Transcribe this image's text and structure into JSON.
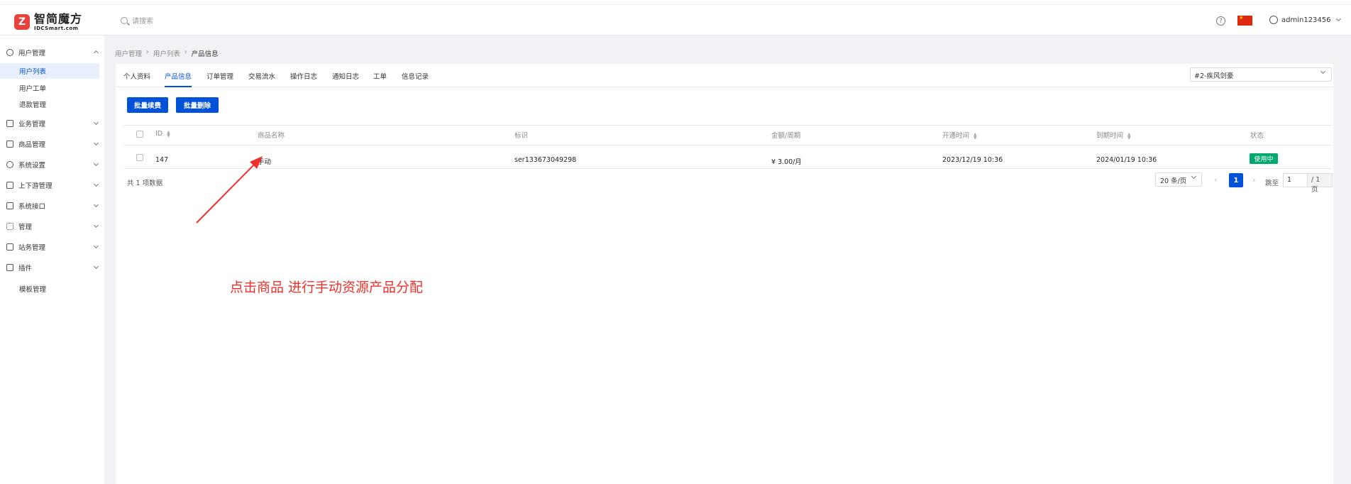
{
  "brand": {
    "name_cn": "智简魔方",
    "name_en": "IDCSmart.com",
    "mark": "Z",
    "color": "#e8403a"
  },
  "header": {
    "search_placeholder": "请搜索",
    "help": "?",
    "user": "admin123456",
    "flag": "cn"
  },
  "sidebar": {
    "items": [
      {
        "label": "用户管理",
        "icon": "user-icon",
        "expanded": true
      },
      {
        "label": "业务管理",
        "icon": "list-icon"
      },
      {
        "label": "商品管理",
        "icon": "cart-icon"
      },
      {
        "label": "系统设置",
        "icon": "gear-icon"
      },
      {
        "label": "上下游管理",
        "icon": "filter-icon"
      },
      {
        "label": "系统接口",
        "icon": "folder-icon"
      },
      {
        "label": "管理",
        "icon": "sun-icon"
      },
      {
        "label": "站务管理",
        "icon": "note-icon"
      },
      {
        "label": "插件",
        "icon": "cube-icon"
      }
    ],
    "sub": [
      "用户列表",
      "用户工单",
      "退款管理"
    ],
    "template": "模板管理"
  },
  "breadcrumb": [
    "用户管理",
    "用户列表",
    "产品信息"
  ],
  "tabs": [
    "个人资料",
    "产品信息",
    "订单管理",
    "交易流水",
    "操作日志",
    "通知日志",
    "工单",
    "信息记录"
  ],
  "active_tab": "产品信息",
  "filter_select": "#2-疾风剑豪",
  "buttons": {
    "renew": "批量续费",
    "delete": "批量删除"
  },
  "table": {
    "columns": [
      "ID",
      "商品名称",
      "标识",
      "金额/周期",
      "开通时间",
      "到期时间",
      "状态"
    ],
    "rows": [
      {
        "id": "147",
        "name": "手动",
        "tag": "ser133673049298",
        "amount": "¥ 3.00/月",
        "open": "2023/12/19 10:36",
        "expire": "2024/01/19 10:36",
        "status": "使用中"
      }
    ]
  },
  "pagination": {
    "total": "共 1 项数据",
    "page_size": "20 条/页",
    "prev": "‹",
    "current": "1",
    "next": "›",
    "jump_label": "跳至",
    "jump_value": "1",
    "total_pages": "/ 1 页"
  },
  "annotation": "点击商品 进行手动资源产品分配",
  "colors": {
    "primary": "#0052d9",
    "success": "#00a870",
    "annotation": "#f0302a"
  }
}
